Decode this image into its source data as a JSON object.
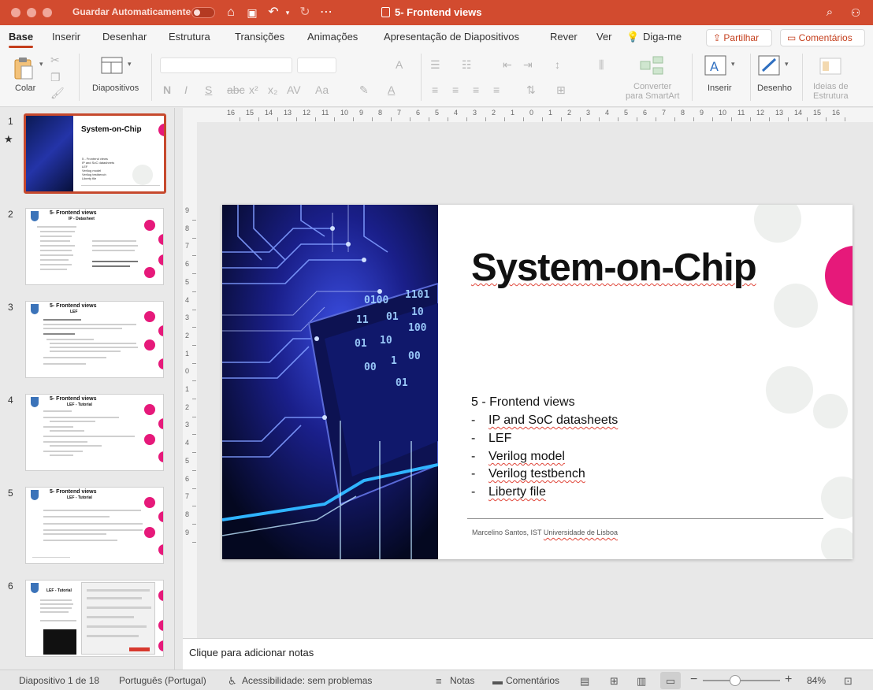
{
  "titlebar": {
    "autosave_label": "Guardar Automaticamente",
    "autosave_state": "off",
    "title": "5- Frontend views"
  },
  "tabs": [
    {
      "label": "Base",
      "active": true
    },
    {
      "label": "Inserir"
    },
    {
      "label": "Desenhar"
    },
    {
      "label": "Estrutura"
    },
    {
      "label": "Transições"
    },
    {
      "label": "Animações"
    },
    {
      "label": "Apresentação de Diapositivos"
    },
    {
      "label": "Rever"
    },
    {
      "label": "Ver"
    },
    {
      "label": "Diga-me"
    }
  ],
  "share": {
    "partilhar": "Partilhar",
    "comentarios": "Comentários"
  },
  "toolbar": {
    "colar": "Colar",
    "diapositivos": "Diapositivos",
    "converter_line1": "Converter",
    "converter_line2": "para SmartArt",
    "inserir": "Inserir",
    "desenho": "Desenho",
    "ideias_line1": "Ideias de",
    "ideias_line2": "Estrutura"
  },
  "thumbnails": [
    {
      "number": "1",
      "title": "System-on-Chip",
      "starred": true,
      "lines": [
        "5 - Frontend views",
        "IP and SoC datasheets",
        "LEF",
        "Verilog model",
        "Verilog testbench",
        "Liberty file"
      ]
    },
    {
      "number": "2",
      "title": "5- Frontend views",
      "subtitle": "IP - Datasheet"
    },
    {
      "number": "3",
      "title": "5- Frontend views",
      "subtitle": "LEF"
    },
    {
      "number": "4",
      "title": "5- Frontend views",
      "subtitle": "LEF - Tutorial"
    },
    {
      "number": "5",
      "title": "5- Frontend views",
      "subtitle": "LEF - Tutorial"
    },
    {
      "number": "6",
      "title": "LEF - Tutorial"
    }
  ],
  "slide": {
    "title": "System-on-Chip",
    "heading": "5 - Frontend views",
    "bullets": [
      "IP and SoC datasheets",
      "LEF",
      "Verilog model",
      "Verilog testbench",
      "Liberty file"
    ],
    "footer_author": "Marcelino Santos, IST",
    "footer_org": "Universidade de Lisboa"
  },
  "notes_placeholder": "Clique para adicionar notas",
  "status": {
    "slide_position": "Diapositivo 1 de 18",
    "language": "Português (Portugal)",
    "accessibility": "Acessibilidade: sem problemas",
    "notes": "Notas",
    "comments": "Comentários",
    "zoom": "84%"
  },
  "colors": {
    "accent": "#d24b2f",
    "magenta": "#e6197a"
  }
}
